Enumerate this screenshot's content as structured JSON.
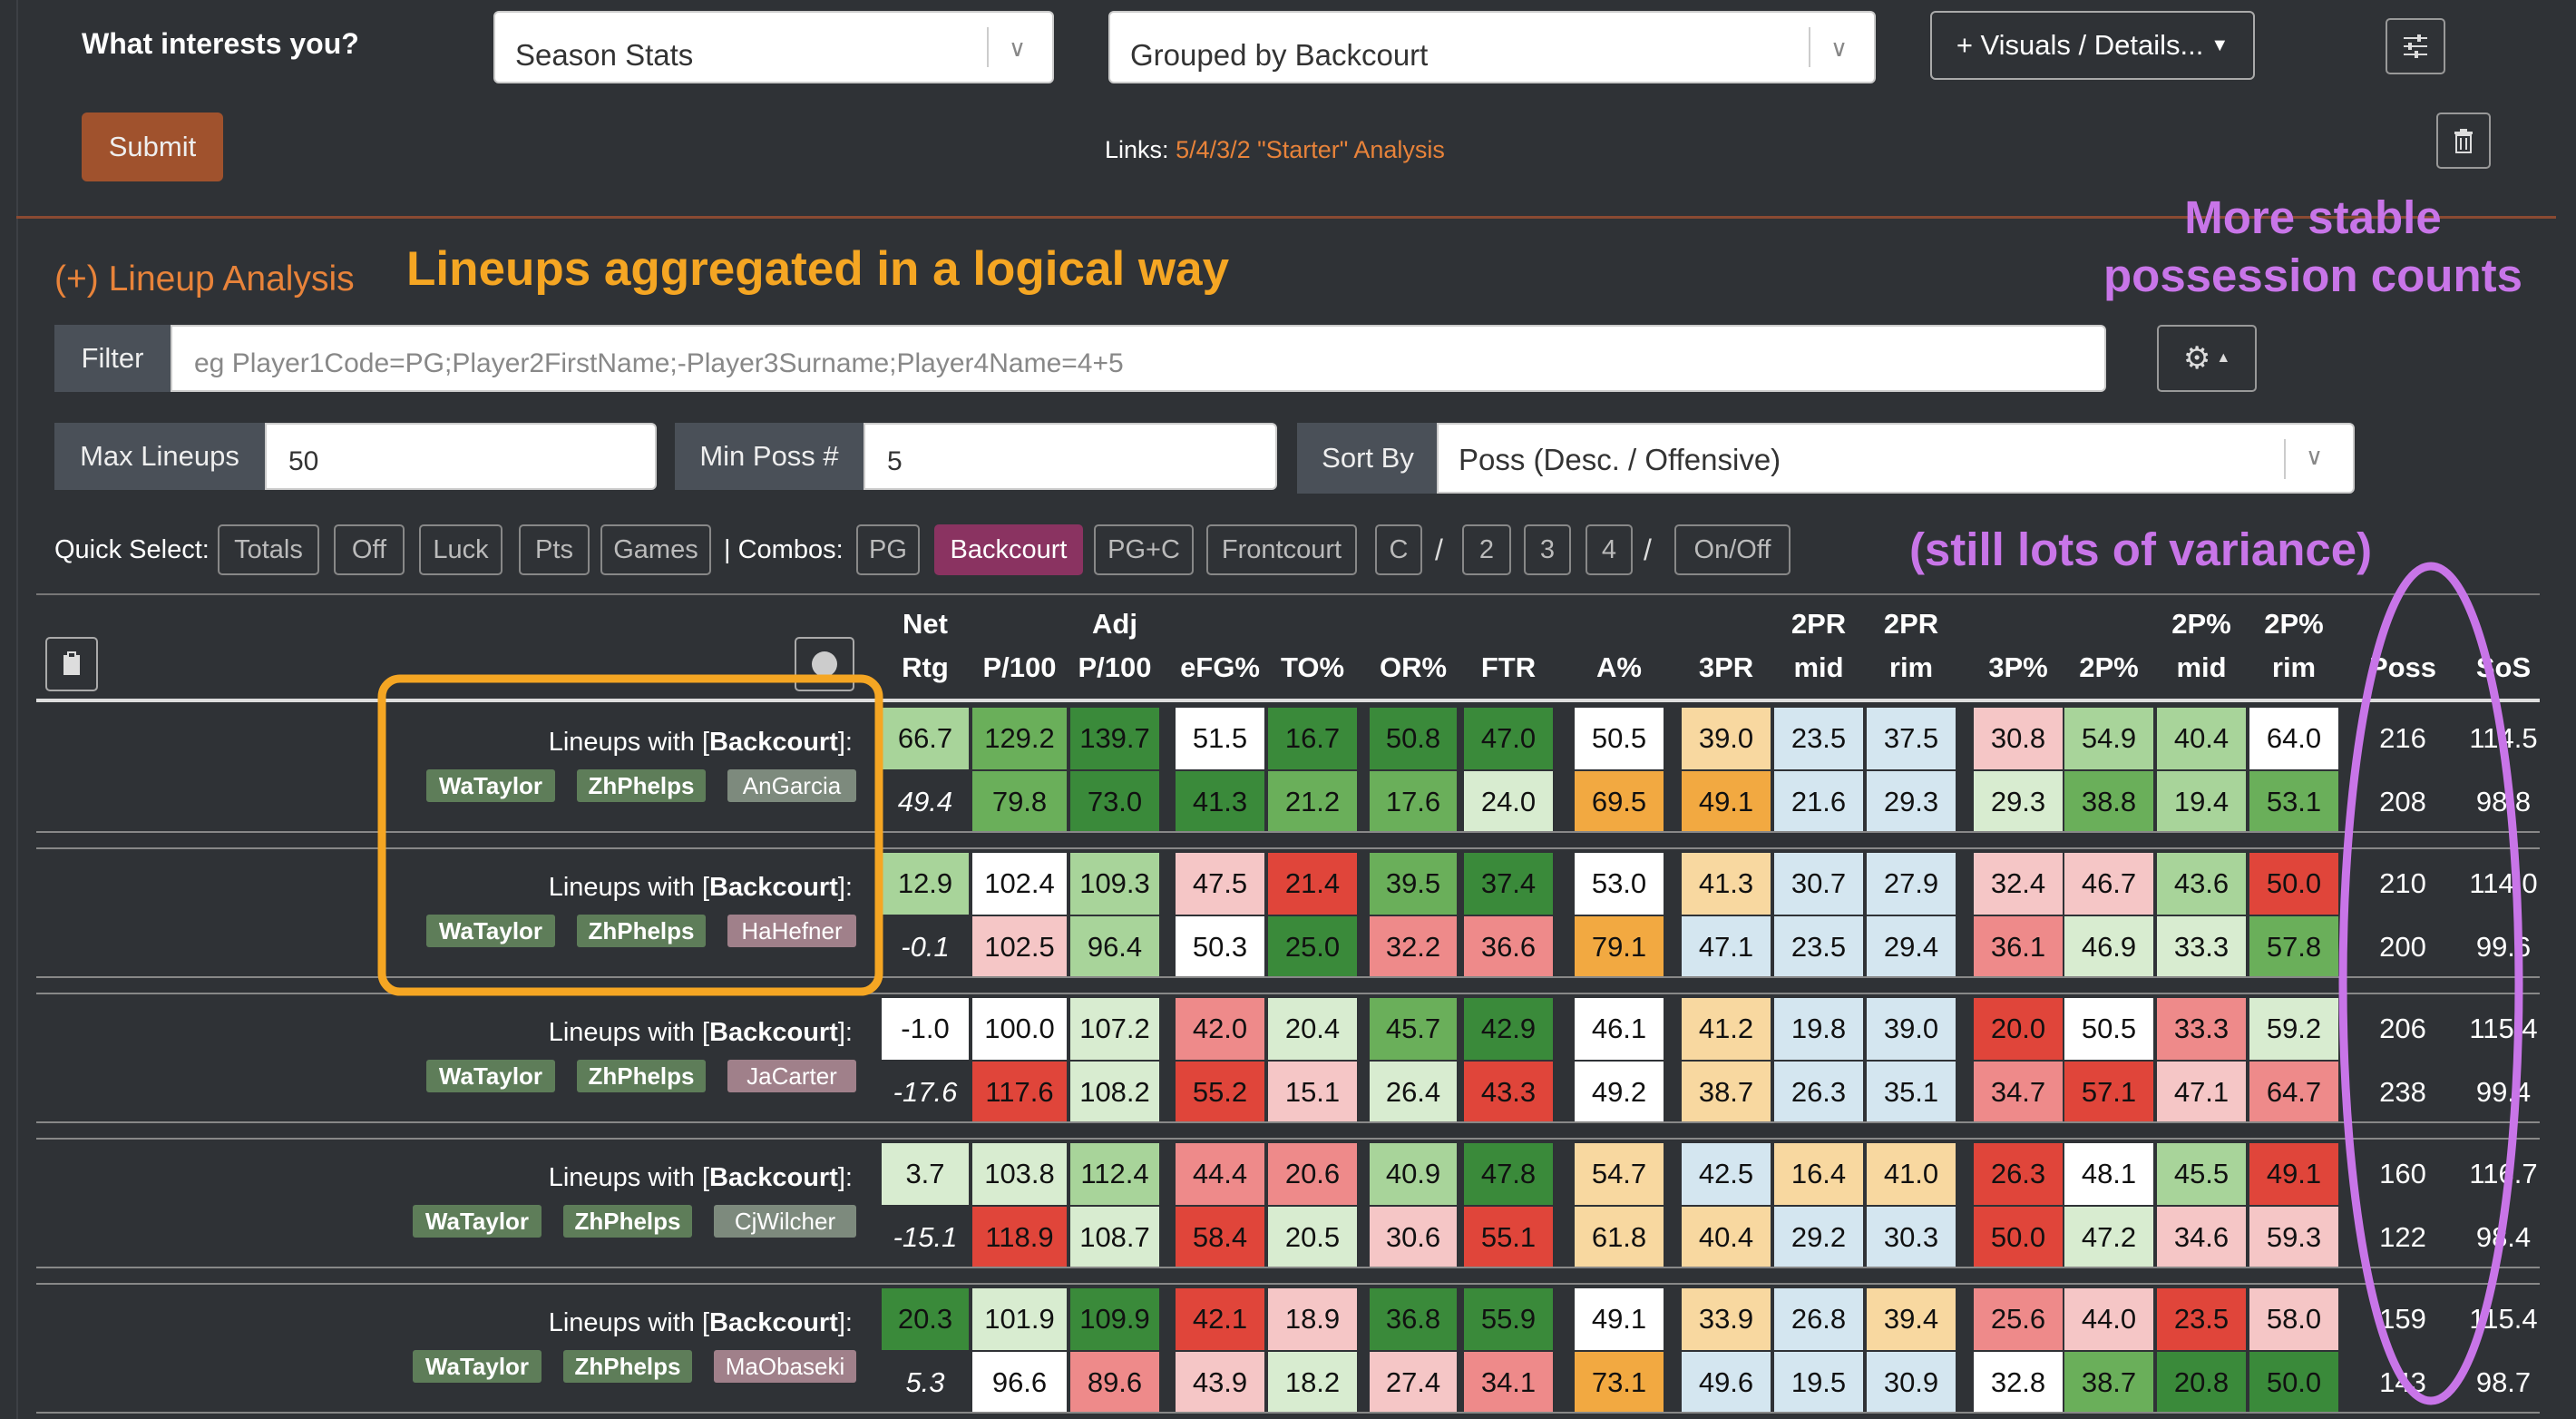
{
  "header": {
    "question": "What interests you?",
    "stats_select": "Season Stats",
    "group_select": "Grouped by Backcourt",
    "visuals_button": "+ Visuals / Details...",
    "submit": "Submit",
    "links_label": "Links:",
    "links_value": "5/4/3/2 \"Starter\" Analysis"
  },
  "lineup_section": {
    "toggle": "(+) Lineup Analysis",
    "annotation_main": "Lineups aggregated in a logical way",
    "annotation_stable_1": "More stable",
    "annotation_stable_2": "possession counts",
    "annotation_variance": "(still lots of variance)",
    "filter_label": "Filter",
    "filter_placeholder": "eg Player1Code=PG;Player2FirstName;-Player3Surname;Player4Name=4+5",
    "max_lineups_label": "Max Lineups",
    "max_lineups_value": "50",
    "min_poss_label": "Min Poss #",
    "min_poss_value": "5",
    "sort_by_label": "Sort By",
    "sort_by_value": "Poss (Desc. / Offensive)",
    "quick_select_label": "Quick Select:",
    "combos_label": "| Combos:",
    "quick_buttons": [
      "Totals",
      "Off",
      "Luck",
      "Pts",
      "Games"
    ],
    "combo_buttons": [
      "PG",
      "Backcourt",
      "PG+C",
      "Frontcourt",
      "C",
      "2",
      "3",
      "4",
      "On/Off"
    ],
    "slash": "/"
  },
  "table": {
    "headers": [
      [
        "Net",
        "Rtg"
      ],
      [
        "",
        "P/100"
      ],
      [
        "Adj",
        "P/100"
      ],
      [
        "",
        "eFG%"
      ],
      [
        "",
        "TO%"
      ],
      [
        "",
        "OR%"
      ],
      [
        "",
        "FTR"
      ],
      [
        "",
        "A%"
      ],
      [
        "",
        "3PR"
      ],
      [
        "2PR",
        "mid"
      ],
      [
        "2PR",
        "rim"
      ],
      [
        "",
        "3P%"
      ],
      [
        "",
        "2P%"
      ],
      [
        "2P%",
        "mid"
      ],
      [
        "2P%",
        "rim"
      ],
      [
        "",
        "Poss"
      ],
      [
        "",
        "SoS"
      ]
    ],
    "group_prefix": "Lineups with [",
    "group_name": "Backcourt",
    "group_suffix": "]:",
    "groups": [
      {
        "players": [
          "WaTaylor",
          "ZhPhelps",
          "AnGarcia"
        ],
        "off": [
          "66.7",
          "129.2",
          "139.7",
          "51.5",
          "16.7",
          "50.8",
          "47.0",
          "50.5",
          "39.0",
          "23.5",
          "37.5",
          "30.8",
          "54.9",
          "40.4",
          "64.0",
          "216",
          "114.5"
        ],
        "def": [
          "49.4",
          "79.8",
          "73.0",
          "41.3",
          "21.2",
          "17.6",
          "24.0",
          "69.5",
          "49.1",
          "21.6",
          "29.3",
          "29.3",
          "38.8",
          "19.4",
          "53.1",
          "208",
          "98.8"
        ]
      },
      {
        "players": [
          "WaTaylor",
          "ZhPhelps",
          "HaHefner"
        ],
        "off": [
          "12.9",
          "102.4",
          "109.3",
          "47.5",
          "21.4",
          "39.5",
          "37.4",
          "53.0",
          "41.3",
          "30.7",
          "27.9",
          "32.4",
          "46.7",
          "43.6",
          "50.0",
          "210",
          "114.0"
        ],
        "def": [
          "-0.1",
          "102.5",
          "96.4",
          "50.3",
          "25.0",
          "32.2",
          "36.6",
          "79.1",
          "47.1",
          "23.5",
          "29.4",
          "36.1",
          "46.9",
          "33.3",
          "57.8",
          "200",
          "99.6"
        ]
      },
      {
        "players": [
          "WaTaylor",
          "ZhPhelps",
          "JaCarter"
        ],
        "off": [
          "-1.0",
          "100.0",
          "107.2",
          "42.0",
          "20.4",
          "45.7",
          "42.9",
          "46.1",
          "41.2",
          "19.8",
          "39.0",
          "20.0",
          "50.5",
          "33.3",
          "59.2",
          "206",
          "115.4"
        ],
        "def": [
          "-17.6",
          "117.6",
          "108.2",
          "55.2",
          "15.1",
          "26.4",
          "43.3",
          "49.2",
          "38.7",
          "26.3",
          "35.1",
          "34.7",
          "57.1",
          "47.1",
          "64.7",
          "238",
          "99.4"
        ]
      },
      {
        "players": [
          "WaTaylor",
          "ZhPhelps",
          "CjWilcher"
        ],
        "off": [
          "3.7",
          "103.8",
          "112.4",
          "44.4",
          "20.6",
          "40.9",
          "47.8",
          "54.7",
          "42.5",
          "16.4",
          "41.0",
          "26.3",
          "48.1",
          "45.5",
          "49.1",
          "160",
          "116.7"
        ],
        "def": [
          "-15.1",
          "118.9",
          "108.7",
          "58.4",
          "20.5",
          "30.6",
          "55.1",
          "61.8",
          "40.4",
          "29.2",
          "30.3",
          "50.0",
          "47.2",
          "34.6",
          "59.3",
          "122",
          "98.4"
        ]
      },
      {
        "players": [
          "WaTaylor",
          "ZhPhelps",
          "MaObaseki"
        ],
        "off": [
          "20.3",
          "101.9",
          "109.9",
          "42.1",
          "18.9",
          "36.8",
          "55.9",
          "49.1",
          "33.9",
          "26.8",
          "39.4",
          "25.6",
          "44.0",
          "23.5",
          "58.0",
          "159",
          "115.4"
        ],
        "def": [
          "5.3",
          "96.6",
          "89.6",
          "43.9",
          "18.2",
          "27.4",
          "34.1",
          "73.1",
          "49.6",
          "19.5",
          "30.9",
          "32.8",
          "38.7",
          "20.8",
          "50.0",
          "143",
          "98.7"
        ]
      }
    ],
    "colors": {
      "dark_green": "#3a8a3a",
      "green": "#6aaf5a",
      "light_green": "#a8d49a",
      "pale_green": "#d8ecd0",
      "white": "#ffffff",
      "pink": "#f5c6c6",
      "light_red": "#ee8a8a",
      "red": "#e0453a",
      "orange": "#f2a941",
      "light_orange": "#f8d8a0",
      "light_blue": "#d4e6f0",
      "dark_bg": "#2f3236"
    }
  }
}
